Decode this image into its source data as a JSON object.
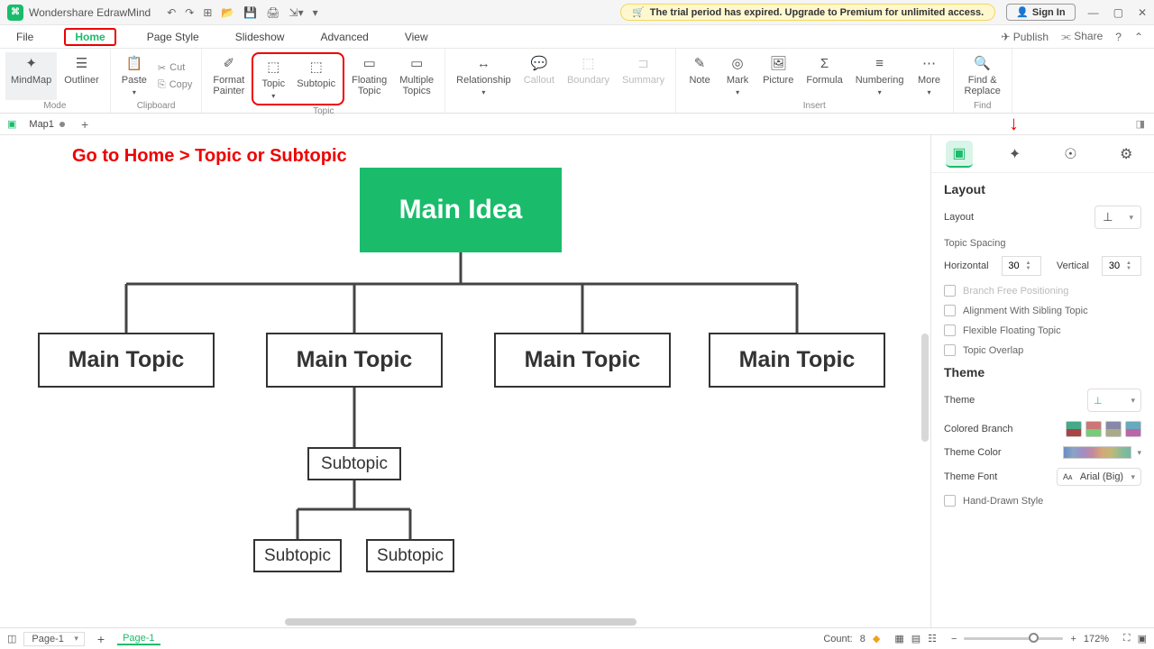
{
  "app": {
    "title": "Wondershare EdrawMind"
  },
  "trial_msg": "The trial period has expired. Upgrade to Premium for unlimited access.",
  "signin": "Sign In",
  "menu": {
    "file": "File",
    "home": "Home",
    "pagestyle": "Page Style",
    "slideshow": "Slideshow",
    "advanced": "Advanced",
    "view": "View",
    "publish": "Publish",
    "share": "Share"
  },
  "ribbon": {
    "mindmap": "MindMap",
    "outliner": "Outliner",
    "mode": "Mode",
    "paste": "Paste",
    "cut": "Cut",
    "copy": "Copy",
    "clipboard": "Clipboard",
    "format_painter": "Format\nPainter",
    "topic": "Topic",
    "subtopic": "Subtopic",
    "floating": "Floating\nTopic",
    "multiple": "Multiple\nTopics",
    "topic_g": "Topic",
    "relationship": "Relationship",
    "callout": "Callout",
    "boundary": "Boundary",
    "summary": "Summary",
    "note": "Note",
    "mark": "Mark",
    "picture": "Picture",
    "formula": "Formula",
    "numbering": "Numbering",
    "more": "More",
    "insert": "Insert",
    "find": "Find &\nReplace",
    "find_g": "Find"
  },
  "tab": {
    "name": "Map1"
  },
  "instruction": "Go to Home > Topic or Subtopic",
  "map": {
    "root": "Main Idea",
    "mt1": "Main Topic",
    "mt2": "Main Topic",
    "mt3": "Main Topic",
    "mt4": "Main Topic",
    "st1": "Subtopic",
    "st2": "Subtopic",
    "st3": "Subtopic"
  },
  "panel": {
    "layout_title": "Layout",
    "layout_label": "Layout",
    "spacing": "Topic Spacing",
    "horizontal": "Horizontal",
    "h_val": "30",
    "vertical": "Vertical",
    "v_val": "30",
    "branch_free": "Branch Free Positioning",
    "align_sibling": "Alignment With Sibling Topic",
    "flex_float": "Flexible Floating Topic",
    "overlap": "Topic Overlap",
    "theme_title": "Theme",
    "theme_label": "Theme",
    "colored_branch": "Colored Branch",
    "theme_color": "Theme Color",
    "theme_font": "Theme Font",
    "font_val": "Arial (Big)",
    "hand_drawn": "Hand-Drawn Style"
  },
  "status": {
    "page_sel": "Page-1",
    "page_tab": "Page-1",
    "count_label": "Count:",
    "count": "8",
    "zoom": "172%"
  }
}
